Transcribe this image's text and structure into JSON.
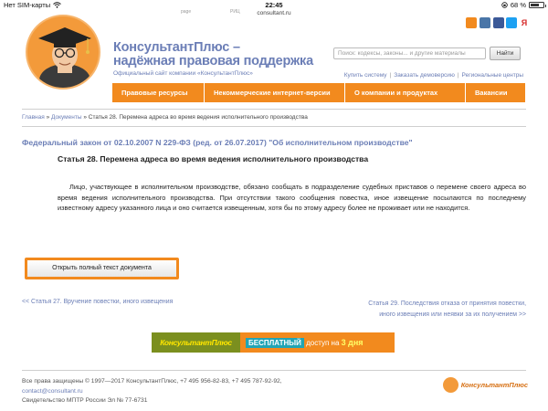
{
  "status_bar": {
    "carrier": "Нет SIM-карты",
    "time": "22:45",
    "battery": "68 %",
    "battery_level": 0.68,
    "url": "consultant.ru"
  },
  "top_tiny": {
    "page": "page",
    "rss": "РИЦ"
  },
  "brand": {
    "title": "КонсультантПлюс –",
    "title2": "надёжная правовая поддержка",
    "subtitle": "Официальный сайт компании «КонсультантПлюс»"
  },
  "social_colors": [
    "#f28a1e",
    "#4a76a8",
    "#3b5998",
    "#1da1f2",
    "#d62828"
  ],
  "search": {
    "placeholder": "Поиск: кодексы, законы... и другие материалы",
    "button": "Найти"
  },
  "util_links": [
    "Купить систему",
    "Заказать демоверсию",
    "Региональные центры"
  ],
  "nav": [
    "Правовые ресурсы",
    "Некоммерческие интернет-версии",
    "О компании и продуктах",
    "Вакансии"
  ],
  "breadcrumb": {
    "home": "Главная",
    "sep": "»",
    "docs": "Документы",
    "current": "Статья 28. Перемена адреса во время ведения исполнительного производства"
  },
  "law_title": "Федеральный закон от 02.10.2007 N 229-ФЗ (ред. от 26.07.2017) \"Об исполнительном производстве\"",
  "article_title": "Статья 28. Перемена адреса во время ведения исполнительного производства",
  "body_text": "Лицо, участвующее в исполнительном производстве, обязано сообщать в подразделение судебных приставов о перемене своего адреса во время ведения исполнительного производства. При отсутствии такого сообщения повестка, иное извещение посылаются по последнему известному адресу указанного лица и оно считается извещенным, хотя бы по этому адресу более не проживает или не находится.",
  "full_text_button": "Открыть полный текст документа",
  "prev_link": "<< Статья 27. Вручение повестки, иного извещения",
  "next_link": {
    "line1": "Статья 29. Последствия отказа от принятия повестки,",
    "line2": "иного извещения или неявки за их получением >>"
  },
  "promo": {
    "brand": "КонсультантПлюс",
    "free": "БЕСПЛАТНЫЙ",
    "access": "доступ на",
    "days": "3 дня"
  },
  "footer": {
    "copyright": "Все права защищены © 1997—2017 КонсультантПлюс, +7 495 956-82-83, +7 495 787-92-92,",
    "email": "contact@consultant.ru",
    "license": "Свидетельство МПТР России Эл № 77-6731",
    "logo_text": "КонсультантПлюс"
  }
}
